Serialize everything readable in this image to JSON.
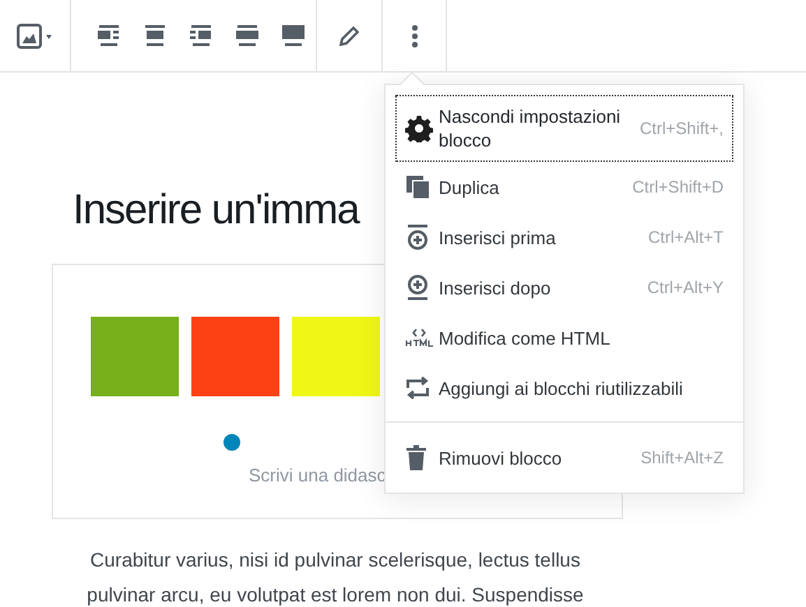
{
  "heading": "Inserire un'imma",
  "gallery": {
    "images": [
      {
        "color": "#77b01a"
      },
      {
        "color": "#fe4115"
      },
      {
        "color": "#f0f716"
      }
    ],
    "caption_placeholder": "Scrivi una didasc"
  },
  "paragraph": "Curabitur varius, nisi id pulvinar scelerisque, lectus tellus pulvinar arcu, eu volutpat est lorem non dui. Suspendisse",
  "menu": {
    "items": [
      {
        "kind": "settings",
        "label": "Nascondi impostazioni blocco",
        "shortcut": "Ctrl+Shift+,",
        "focused": true
      },
      {
        "kind": "duplicate",
        "label": "Duplica",
        "shortcut": "Ctrl+Shift+D",
        "focused": false
      },
      {
        "kind": "insert-before",
        "label": "Inserisci prima",
        "shortcut": "Ctrl+Alt+T",
        "focused": false
      },
      {
        "kind": "insert-after",
        "label": "Inserisci dopo",
        "shortcut": "Ctrl+Alt+Y",
        "focused": false
      },
      {
        "kind": "html",
        "label": "Modifica come HTML",
        "focused": false
      },
      {
        "kind": "reusable",
        "label": "Aggiungi ai blocchi riutilizzabili",
        "focused": false
      },
      {
        "kind": "remove",
        "label": "Rimuovi blocco",
        "shortcut": "Shift+Alt+Z",
        "focused": false
      }
    ]
  }
}
